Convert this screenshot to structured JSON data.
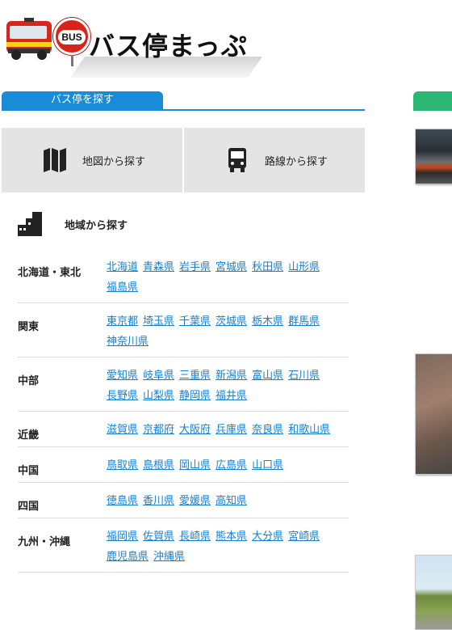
{
  "site": {
    "title": "バス停まっぷ",
    "sign_text": "BUS"
  },
  "section": {
    "tab_label": "バス停を探す"
  },
  "search_buttons": [
    {
      "label": "地図から探す",
      "icon": "map-icon"
    },
    {
      "label": "路線から探す",
      "icon": "bus-icon"
    }
  ],
  "region_heading": {
    "label": "地域から探す",
    "icon": "building-icon"
  },
  "regions": [
    {
      "name": "北海道・東北",
      "prefs": [
        "北海道",
        "青森県",
        "岩手県",
        "宮城県",
        "秋田県",
        "山形県",
        "福島県"
      ]
    },
    {
      "name": "関東",
      "prefs": [
        "東京都",
        "埼玉県",
        "千葉県",
        "茨城県",
        "栃木県",
        "群馬県",
        "神奈川県"
      ]
    },
    {
      "name": "中部",
      "prefs": [
        "愛知県",
        "岐阜県",
        "三重県",
        "新潟県",
        "富山県",
        "石川県",
        "長野県",
        "山梨県",
        "静岡県",
        "福井県"
      ]
    },
    {
      "name": "近畿",
      "prefs": [
        "滋賀県",
        "京都府",
        "大阪府",
        "兵庫県",
        "奈良県",
        "和歌山県"
      ]
    },
    {
      "name": "中国",
      "prefs": [
        "鳥取県",
        "島根県",
        "岡山県",
        "広島県",
        "山口県"
      ]
    },
    {
      "name": "四国",
      "prefs": [
        "徳島県",
        "香川県",
        "愛媛県",
        "高知県"
      ]
    },
    {
      "name": "九州・沖縄",
      "prefs": [
        "福岡県",
        "佐賀県",
        "長崎県",
        "熊本県",
        "大分県",
        "宮崎県",
        "鹿児島県",
        "沖縄県"
      ]
    }
  ],
  "colors": {
    "accent": "#1a8bd6",
    "link": "#1a7fc9",
    "button_bg": "#e4e4e4",
    "side_tab": "#2bb673"
  }
}
